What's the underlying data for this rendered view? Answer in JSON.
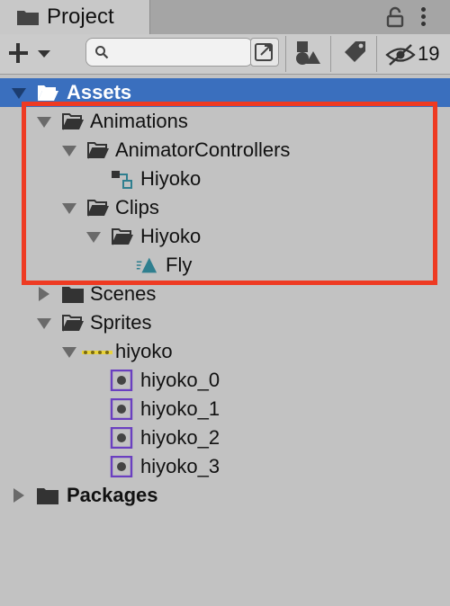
{
  "window": {
    "tab_title": "Project"
  },
  "toolbar": {
    "hidden_count": "19",
    "search_value": ""
  },
  "tree": {
    "assets": "Assets",
    "animations": "Animations",
    "animator_controllers": "AnimatorControllers",
    "controller_hiyoko": "Hiyoko",
    "clips": "Clips",
    "clips_hiyoko": "Hiyoko",
    "fly": "Fly",
    "scenes": "Scenes",
    "sprites": "Sprites",
    "sprite_hiyoko": "hiyoko",
    "hiyoko_0": "hiyoko_0",
    "hiyoko_1": "hiyoko_1",
    "hiyoko_2": "hiyoko_2",
    "hiyoko_3": "hiyoko_3",
    "packages": "Packages"
  },
  "colors": {
    "selection": "#3a6fbe",
    "highlight_border": "#ee3a22",
    "sprite_purple": "#6a3fc0",
    "clip_teal": "#2f7f8f"
  }
}
